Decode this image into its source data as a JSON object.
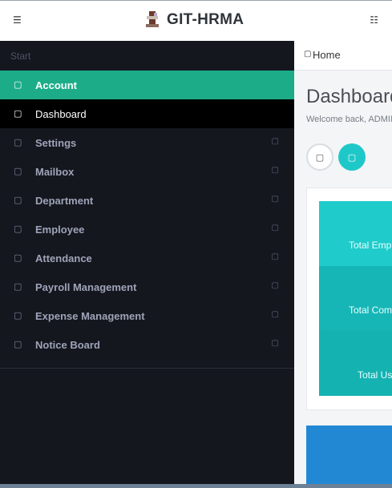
{
  "topbar": {
    "menu_icon": "menu-icon",
    "right_icon": "user-icon",
    "brand": "GIT-HRMA"
  },
  "sidebar": {
    "section_label": "Start",
    "items": [
      {
        "label": "Account",
        "icon": "user-icon",
        "state": "active",
        "has_chevron": false
      },
      {
        "label": "Dashboard",
        "icon": "dashboard-icon",
        "state": "current",
        "has_chevron": false
      },
      {
        "label": "Settings",
        "icon": "gear-icon",
        "has_chevron": true
      },
      {
        "label": "Mailbox",
        "icon": "mail-icon",
        "has_chevron": true
      },
      {
        "label": "Department",
        "icon": "building-icon",
        "has_chevron": true
      },
      {
        "label": "Employee",
        "icon": "users-icon",
        "has_chevron": true
      },
      {
        "label": "Attendance",
        "icon": "calendar-icon",
        "has_chevron": true
      },
      {
        "label": "Payroll Management",
        "icon": "money-icon",
        "has_chevron": true
      },
      {
        "label": "Expense Management",
        "icon": "wallet-icon",
        "has_chevron": true
      },
      {
        "label": "Notice Board",
        "icon": "bell-icon",
        "has_chevron": true
      }
    ]
  },
  "main": {
    "breadcrumb": "Home",
    "title": "Dashboard",
    "subtitle": "Welcome back, ADMIN",
    "stats": [
      "Total Employees",
      "Total Companies",
      "Total Users"
    ]
  },
  "colors": {
    "sidebar_bg": "#15171f",
    "active": "#1cad88",
    "teal": "#1fc8c8",
    "blue": "#2388d4"
  }
}
